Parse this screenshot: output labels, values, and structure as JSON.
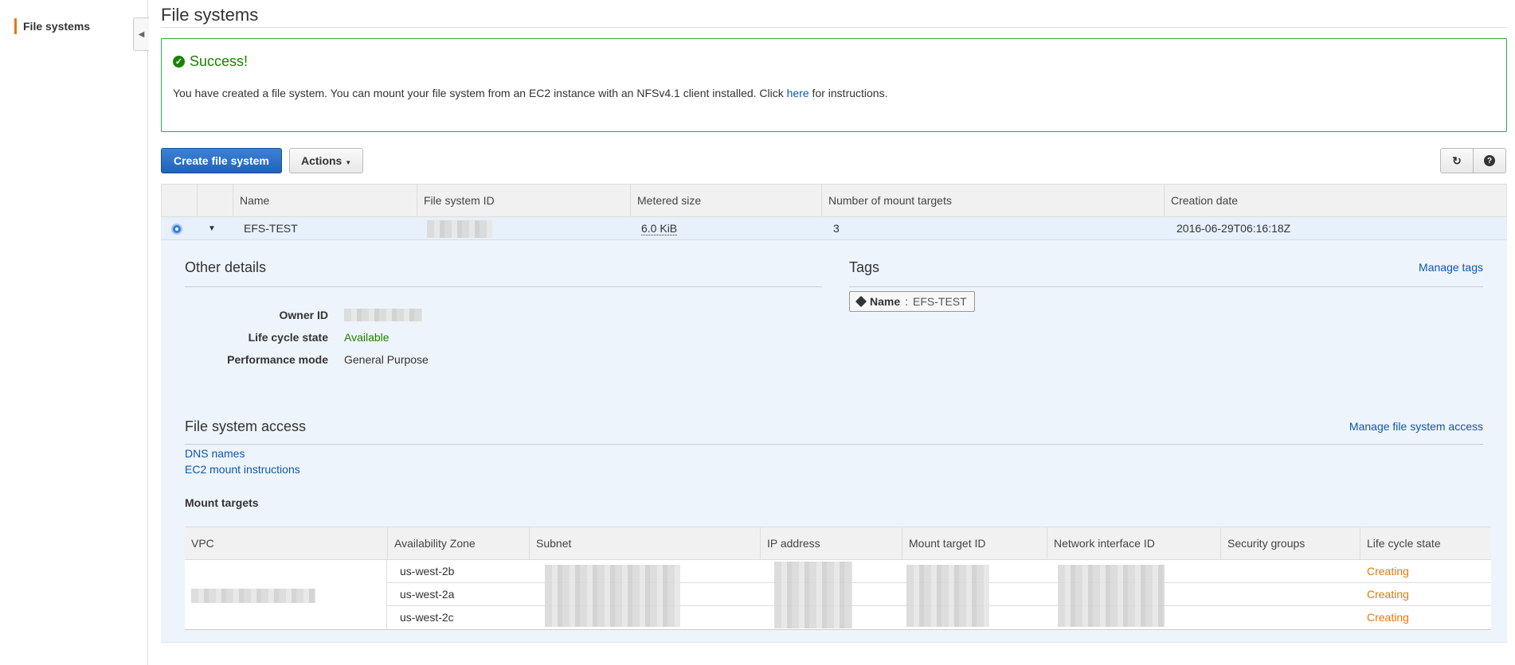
{
  "sidebar": {
    "items": [
      {
        "label": "File systems",
        "active": true
      }
    ]
  },
  "page": {
    "title": "File systems"
  },
  "alert": {
    "title": "Success!",
    "message_before": "You have created a file system. You can mount your file system from an EC2 instance with an NFSv4.1 client installed. Click ",
    "link": "here",
    "message_after": " for instructions."
  },
  "toolbar": {
    "create_label": "Create file system",
    "actions_label": "Actions"
  },
  "table": {
    "columns": [
      "Name",
      "File system ID",
      "Metered size",
      "Number of mount targets",
      "Creation date"
    ],
    "rows": [
      {
        "name": "EFS-TEST",
        "metered_size": "6.0 KiB",
        "mount_targets": "3",
        "creation_date": "2016-06-29T06:16:18Z"
      }
    ]
  },
  "details": {
    "other_title": "Other details",
    "owner_id_label": "Owner ID",
    "lifecycle_label": "Life cycle state",
    "lifecycle_value": "Available",
    "performance_label": "Performance mode",
    "performance_value": "General Purpose",
    "tags_title": "Tags",
    "manage_tags": "Manage tags",
    "tag_key": "Name",
    "tag_sep": ":",
    "tag_value": "EFS-TEST",
    "access_title": "File system access",
    "manage_access": "Manage file system access",
    "dns_link": "DNS names",
    "ec2_link": "EC2 mount instructions",
    "mount_targets_title": "Mount targets"
  },
  "mount_table": {
    "columns": [
      "VPC",
      "Availability Zone",
      "Subnet",
      "IP address",
      "Mount target ID",
      "Network interface ID",
      "Security groups",
      "Life cycle state"
    ],
    "rows": [
      {
        "az": "us-west-2b",
        "state": "Creating"
      },
      {
        "az": "us-west-2a",
        "state": "Creating"
      },
      {
        "az": "us-west-2c",
        "state": "Creating"
      }
    ]
  },
  "colors": {
    "accent": "#e47911",
    "primary": "#1f63b9",
    "success": "#1d8102",
    "link": "#0e57b0"
  }
}
